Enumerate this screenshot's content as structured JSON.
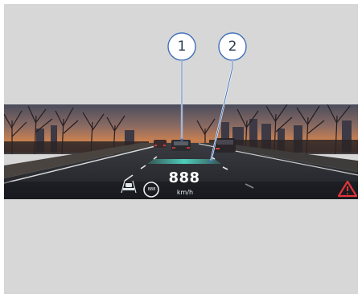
{
  "hud": {
    "speed_value": "888",
    "speed_unit": "km/h",
    "speed_limit_value": "888",
    "icons": [
      "lane-keep-assist-icon",
      "speed-limit-sign-icon",
      "hazard-warning-icon"
    ],
    "colors": {
      "guidance_line": "#4fd6c2",
      "hazard": "#e0353a"
    }
  },
  "callouts": [
    {
      "number": "1",
      "target": "vehicle-ahead"
    },
    {
      "number": "2",
      "target": "guidance-line"
    }
  ],
  "colors": {
    "callout_ring": "#3f6fb8",
    "background_panel": "#d7d7d7"
  }
}
